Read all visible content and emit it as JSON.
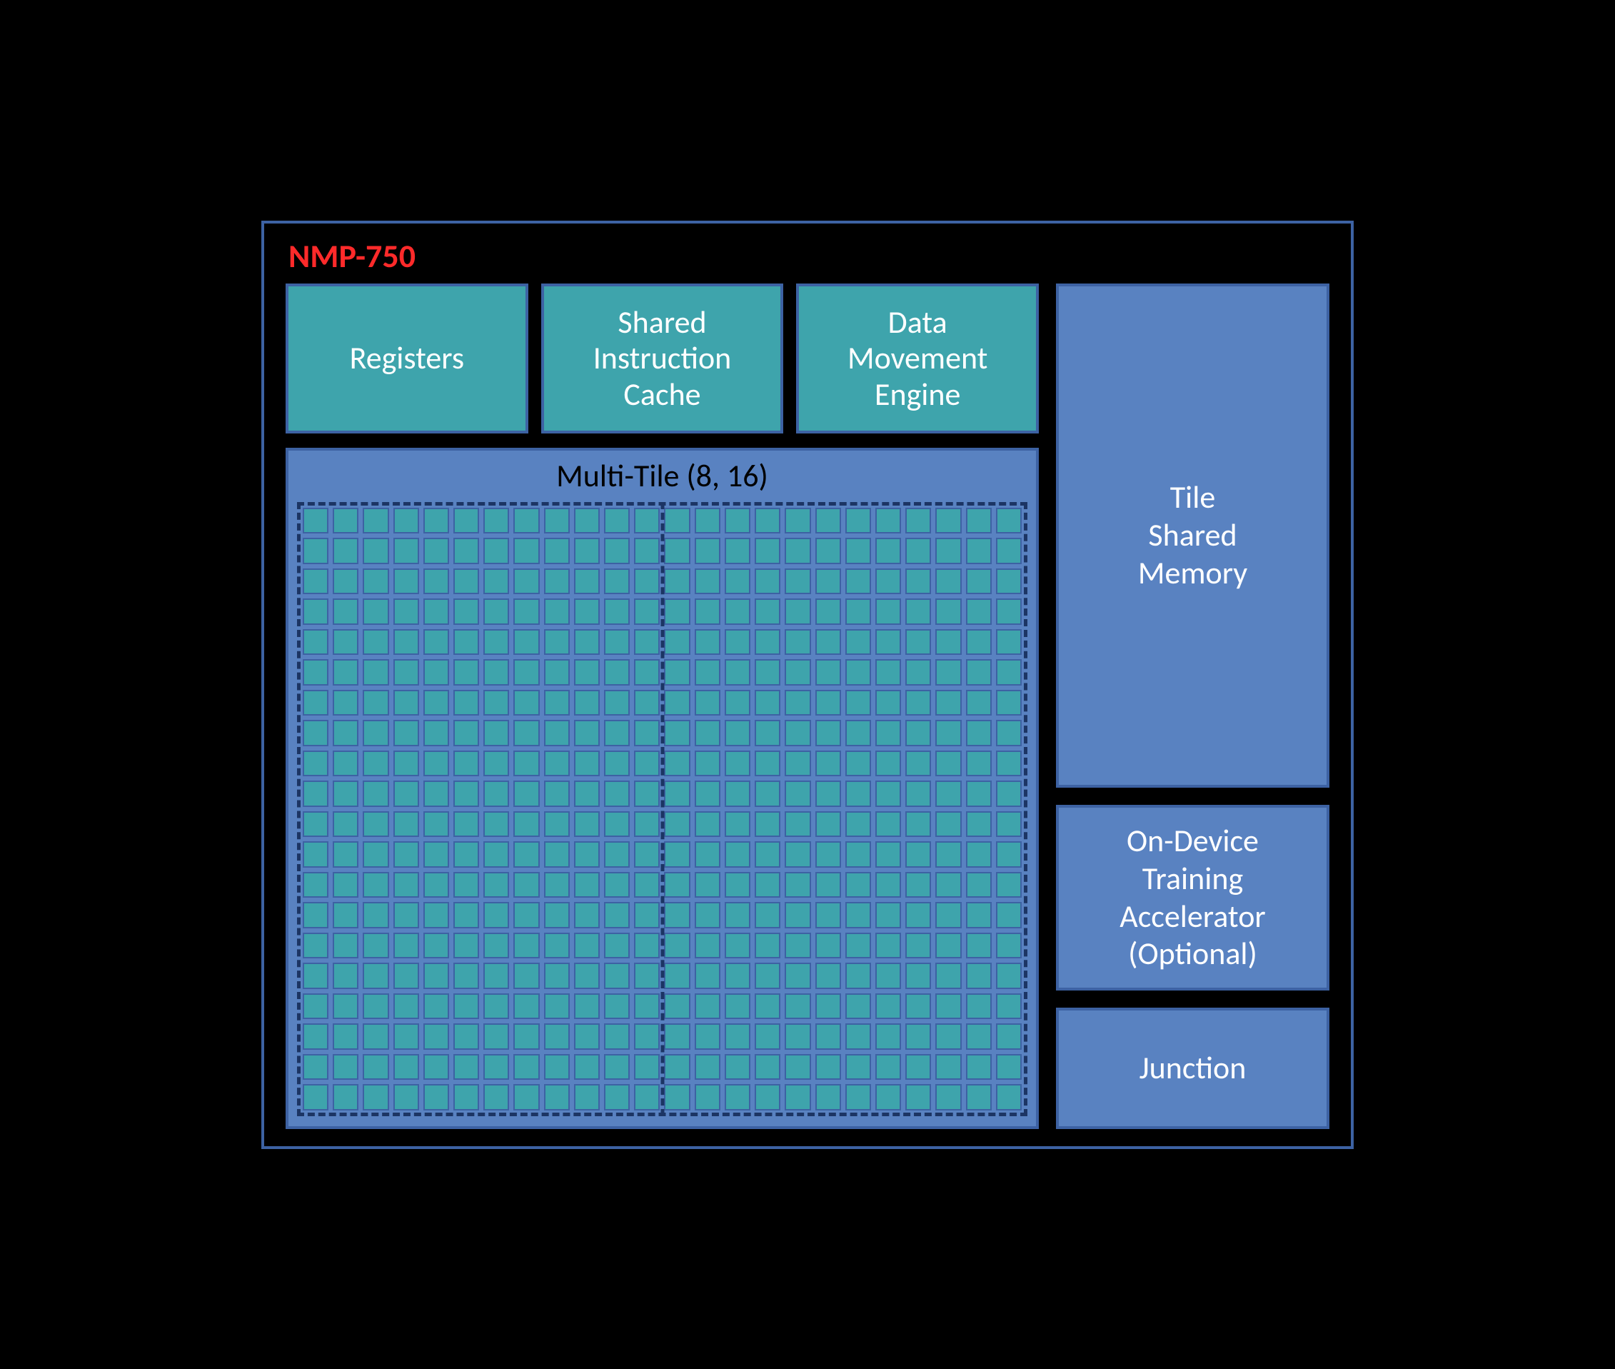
{
  "title": "NMP-750",
  "topBlocks": [
    {
      "key": "registers",
      "label": "Registers"
    },
    {
      "key": "sic",
      "label": "Shared\nInstruction\nCache"
    },
    {
      "key": "dme",
      "label": "Data\nMovement\nEngine"
    }
  ],
  "multiTile": {
    "header": "Multi-Tile (8, 16)",
    "grid": {
      "cols": 24,
      "rows": 20
    }
  },
  "rightBlocks": [
    {
      "key": "tsm",
      "label": "Tile\nShared\nMemory",
      "cls": "tile-shared"
    },
    {
      "key": "odt",
      "label": "On-Device\nTraining\nAccelerator\n(Optional)",
      "cls": "odt"
    },
    {
      "key": "junction",
      "label": "Junction",
      "cls": "junction"
    }
  ]
}
